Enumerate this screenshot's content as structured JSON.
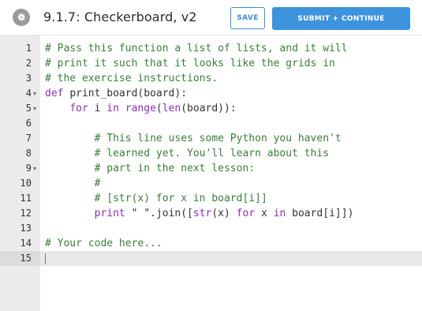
{
  "header": {
    "title": "9.1.7: Checkerboard, v2",
    "save_label": "SAVE",
    "submit_label": "SUBMIT + CONTINUE",
    "settings_icon": "gear-icon"
  },
  "editor": {
    "language": "python",
    "active_line": 15,
    "lines": [
      {
        "num": "1",
        "fold": "",
        "tokens": [
          {
            "t": "# Pass this function a list of lists, and it will",
            "c": "cmt"
          }
        ]
      },
      {
        "num": "2",
        "fold": "",
        "tokens": [
          {
            "t": "# print it such that it looks like the grids in",
            "c": "cmt"
          }
        ]
      },
      {
        "num": "3",
        "fold": "",
        "tokens": [
          {
            "t": "# the exercise instructions.",
            "c": "cmt"
          }
        ]
      },
      {
        "num": "4",
        "fold": "▾",
        "tokens": [
          {
            "t": "def ",
            "c": "kw"
          },
          {
            "t": "print_board(board):",
            "c": "fn"
          }
        ]
      },
      {
        "num": "5",
        "fold": "▾",
        "tokens": [
          {
            "t": "    ",
            "c": "plain"
          },
          {
            "t": "for ",
            "c": "kw"
          },
          {
            "t": "i ",
            "c": "plain"
          },
          {
            "t": "in ",
            "c": "kw"
          },
          {
            "t": "range",
            "c": "bi"
          },
          {
            "t": "(",
            "c": "plain"
          },
          {
            "t": "len",
            "c": "bi"
          },
          {
            "t": "(board)):",
            "c": "plain"
          }
        ]
      },
      {
        "num": "6",
        "fold": "",
        "tokens": [
          {
            "t": "",
            "c": "plain"
          }
        ]
      },
      {
        "num": "7",
        "fold": "",
        "tokens": [
          {
            "t": "        ",
            "c": "plain"
          },
          {
            "t": "# This line uses some Python you haven't",
            "c": "cmt"
          }
        ]
      },
      {
        "num": "8",
        "fold": "",
        "tokens": [
          {
            "t": "        ",
            "c": "plain"
          },
          {
            "t": "# learned yet. You'll learn about this",
            "c": "cmt"
          }
        ]
      },
      {
        "num": "9",
        "fold": "▾",
        "tokens": [
          {
            "t": "        ",
            "c": "plain"
          },
          {
            "t": "# part in the next lesson:",
            "c": "cmt"
          }
        ]
      },
      {
        "num": "10",
        "fold": "",
        "tokens": [
          {
            "t": "        ",
            "c": "plain"
          },
          {
            "t": "#",
            "c": "cmt"
          }
        ]
      },
      {
        "num": "11",
        "fold": "",
        "tokens": [
          {
            "t": "        ",
            "c": "plain"
          },
          {
            "t": "# [str(x) for x in board[i]]",
            "c": "cmt"
          }
        ]
      },
      {
        "num": "12",
        "fold": "",
        "tokens": [
          {
            "t": "        ",
            "c": "plain"
          },
          {
            "t": "print ",
            "c": "kw"
          },
          {
            "t": "\" \"",
            "c": "str"
          },
          {
            "t": ".join([",
            "c": "plain"
          },
          {
            "t": "str",
            "c": "bi"
          },
          {
            "t": "(x) ",
            "c": "plain"
          },
          {
            "t": "for ",
            "c": "kw"
          },
          {
            "t": "x ",
            "c": "plain"
          },
          {
            "t": "in ",
            "c": "kw"
          },
          {
            "t": "board[i]])",
            "c": "plain"
          }
        ]
      },
      {
        "num": "13",
        "fold": "",
        "tokens": [
          {
            "t": "",
            "c": "plain"
          }
        ]
      },
      {
        "num": "14",
        "fold": "",
        "tokens": [
          {
            "t": "# Your code here...",
            "c": "cmt"
          }
        ]
      },
      {
        "num": "15",
        "fold": "",
        "tokens": [
          {
            "t": "",
            "c": "plain"
          }
        ]
      }
    ]
  },
  "colors": {
    "accent": "#3d93dc",
    "comment": "#3b7d3b",
    "keyword": "#8b2fb6",
    "gutter": "#ebebeb",
    "active_line": "#e8e8e8"
  }
}
